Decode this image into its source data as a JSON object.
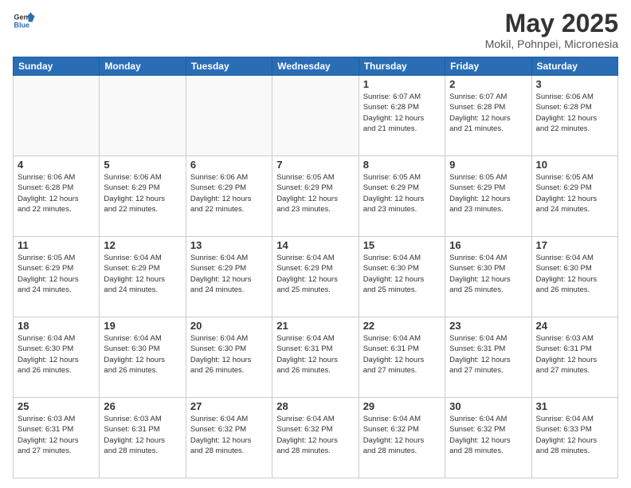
{
  "header": {
    "logo_general": "General",
    "logo_blue": "Blue",
    "month_title": "May 2025",
    "location": "Mokil, Pohnpei, Micronesia"
  },
  "days_of_week": [
    "Sunday",
    "Monday",
    "Tuesday",
    "Wednesday",
    "Thursday",
    "Friday",
    "Saturday"
  ],
  "weeks": [
    [
      {
        "day": "",
        "info": ""
      },
      {
        "day": "",
        "info": ""
      },
      {
        "day": "",
        "info": ""
      },
      {
        "day": "",
        "info": ""
      },
      {
        "day": "1",
        "info": "Sunrise: 6:07 AM\nSunset: 6:28 PM\nDaylight: 12 hours\nand 21 minutes."
      },
      {
        "day": "2",
        "info": "Sunrise: 6:07 AM\nSunset: 6:28 PM\nDaylight: 12 hours\nand 21 minutes."
      },
      {
        "day": "3",
        "info": "Sunrise: 6:06 AM\nSunset: 6:28 PM\nDaylight: 12 hours\nand 22 minutes."
      }
    ],
    [
      {
        "day": "4",
        "info": "Sunrise: 6:06 AM\nSunset: 6:28 PM\nDaylight: 12 hours\nand 22 minutes."
      },
      {
        "day": "5",
        "info": "Sunrise: 6:06 AM\nSunset: 6:29 PM\nDaylight: 12 hours\nand 22 minutes."
      },
      {
        "day": "6",
        "info": "Sunrise: 6:06 AM\nSunset: 6:29 PM\nDaylight: 12 hours\nand 22 minutes."
      },
      {
        "day": "7",
        "info": "Sunrise: 6:05 AM\nSunset: 6:29 PM\nDaylight: 12 hours\nand 23 minutes."
      },
      {
        "day": "8",
        "info": "Sunrise: 6:05 AM\nSunset: 6:29 PM\nDaylight: 12 hours\nand 23 minutes."
      },
      {
        "day": "9",
        "info": "Sunrise: 6:05 AM\nSunset: 6:29 PM\nDaylight: 12 hours\nand 23 minutes."
      },
      {
        "day": "10",
        "info": "Sunrise: 6:05 AM\nSunset: 6:29 PM\nDaylight: 12 hours\nand 24 minutes."
      }
    ],
    [
      {
        "day": "11",
        "info": "Sunrise: 6:05 AM\nSunset: 6:29 PM\nDaylight: 12 hours\nand 24 minutes."
      },
      {
        "day": "12",
        "info": "Sunrise: 6:04 AM\nSunset: 6:29 PM\nDaylight: 12 hours\nand 24 minutes."
      },
      {
        "day": "13",
        "info": "Sunrise: 6:04 AM\nSunset: 6:29 PM\nDaylight: 12 hours\nand 24 minutes."
      },
      {
        "day": "14",
        "info": "Sunrise: 6:04 AM\nSunset: 6:29 PM\nDaylight: 12 hours\nand 25 minutes."
      },
      {
        "day": "15",
        "info": "Sunrise: 6:04 AM\nSunset: 6:30 PM\nDaylight: 12 hours\nand 25 minutes."
      },
      {
        "day": "16",
        "info": "Sunrise: 6:04 AM\nSunset: 6:30 PM\nDaylight: 12 hours\nand 25 minutes."
      },
      {
        "day": "17",
        "info": "Sunrise: 6:04 AM\nSunset: 6:30 PM\nDaylight: 12 hours\nand 26 minutes."
      }
    ],
    [
      {
        "day": "18",
        "info": "Sunrise: 6:04 AM\nSunset: 6:30 PM\nDaylight: 12 hours\nand 26 minutes."
      },
      {
        "day": "19",
        "info": "Sunrise: 6:04 AM\nSunset: 6:30 PM\nDaylight: 12 hours\nand 26 minutes."
      },
      {
        "day": "20",
        "info": "Sunrise: 6:04 AM\nSunset: 6:30 PM\nDaylight: 12 hours\nand 26 minutes."
      },
      {
        "day": "21",
        "info": "Sunrise: 6:04 AM\nSunset: 6:31 PM\nDaylight: 12 hours\nand 26 minutes."
      },
      {
        "day": "22",
        "info": "Sunrise: 6:04 AM\nSunset: 6:31 PM\nDaylight: 12 hours\nand 27 minutes."
      },
      {
        "day": "23",
        "info": "Sunrise: 6:04 AM\nSunset: 6:31 PM\nDaylight: 12 hours\nand 27 minutes."
      },
      {
        "day": "24",
        "info": "Sunrise: 6:03 AM\nSunset: 6:31 PM\nDaylight: 12 hours\nand 27 minutes."
      }
    ],
    [
      {
        "day": "25",
        "info": "Sunrise: 6:03 AM\nSunset: 6:31 PM\nDaylight: 12 hours\nand 27 minutes."
      },
      {
        "day": "26",
        "info": "Sunrise: 6:03 AM\nSunset: 6:31 PM\nDaylight: 12 hours\nand 28 minutes."
      },
      {
        "day": "27",
        "info": "Sunrise: 6:04 AM\nSunset: 6:32 PM\nDaylight: 12 hours\nand 28 minutes."
      },
      {
        "day": "28",
        "info": "Sunrise: 6:04 AM\nSunset: 6:32 PM\nDaylight: 12 hours\nand 28 minutes."
      },
      {
        "day": "29",
        "info": "Sunrise: 6:04 AM\nSunset: 6:32 PM\nDaylight: 12 hours\nand 28 minutes."
      },
      {
        "day": "30",
        "info": "Sunrise: 6:04 AM\nSunset: 6:32 PM\nDaylight: 12 hours\nand 28 minutes."
      },
      {
        "day": "31",
        "info": "Sunrise: 6:04 AM\nSunset: 6:33 PM\nDaylight: 12 hours\nand 28 minutes."
      }
    ]
  ]
}
